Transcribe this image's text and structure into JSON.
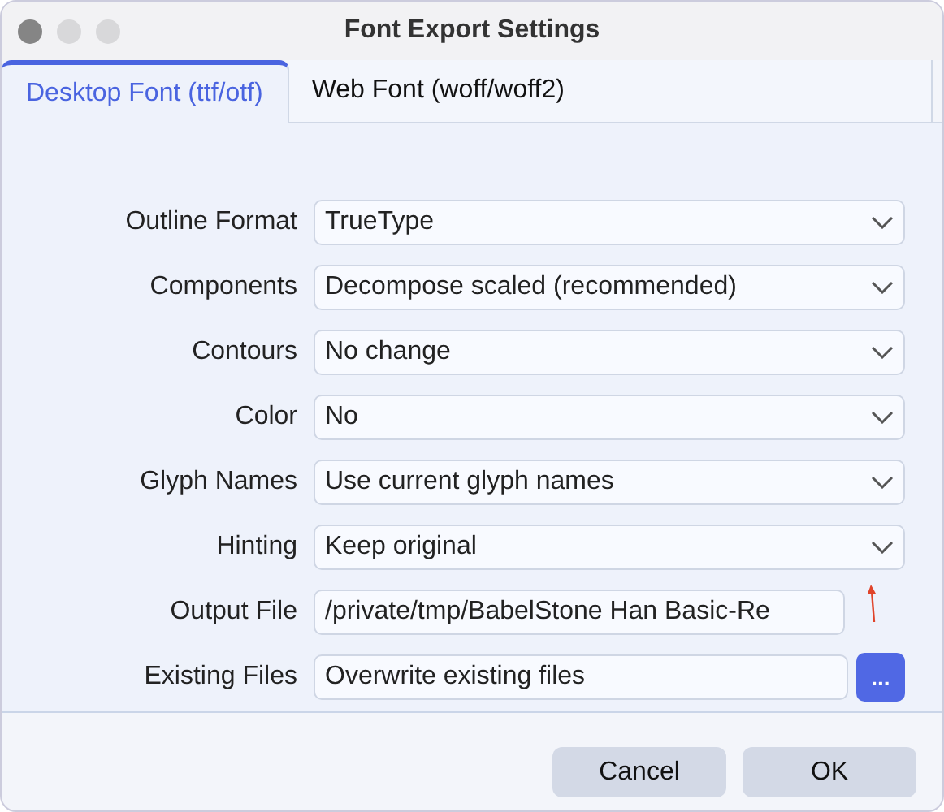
{
  "window": {
    "title": "Font Export Settings"
  },
  "tabs": [
    {
      "label": "Desktop Font (ttf/otf)",
      "selected": true
    },
    {
      "label": "Web Font (woff/woff2)",
      "selected": false
    }
  ],
  "fields": [
    {
      "label": "Outline Format",
      "kind": "dropdown",
      "value": "TrueType"
    },
    {
      "label": "Components",
      "kind": "dropdown",
      "value": "Decompose scaled (recommended)"
    },
    {
      "label": "Contours",
      "kind": "dropdown",
      "value": "No change"
    },
    {
      "label": "Color",
      "kind": "dropdown",
      "value": "No"
    },
    {
      "label": "Glyph Names",
      "kind": "dropdown",
      "value": "Use current glyph names"
    },
    {
      "label": "Hinting",
      "kind": "dropdown",
      "value": "Keep original"
    },
    {
      "label": "Output File",
      "kind": "text",
      "value": "/private/tmp/BabelStone Han Basic-Re"
    },
    {
      "label": "Existing Files",
      "kind": "browse",
      "value": "Overwrite existing files",
      "button": "..."
    }
  ],
  "buttons": [
    "Cancel",
    "OK"
  ]
}
